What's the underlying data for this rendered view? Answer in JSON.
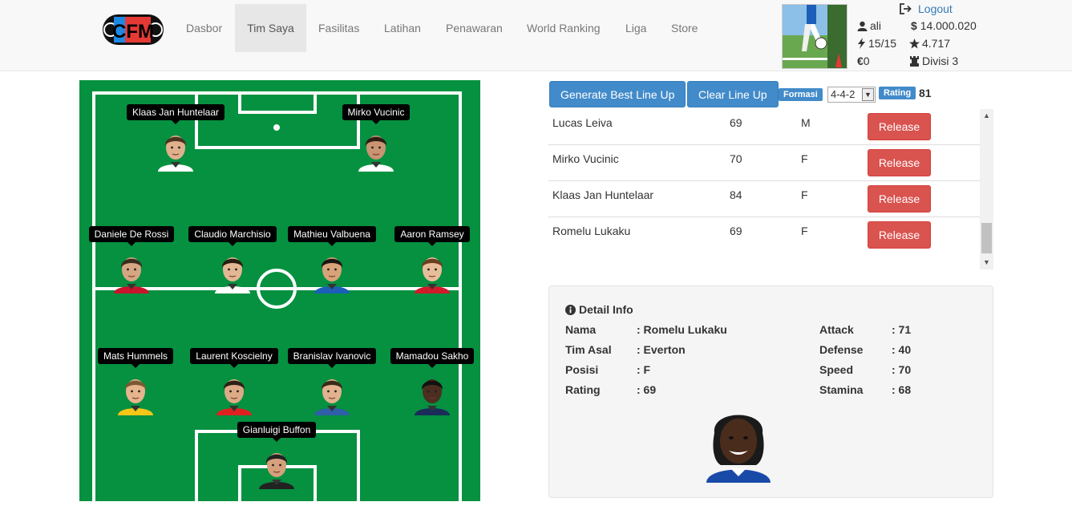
{
  "nav": {
    "logo_text": "CFM",
    "items": [
      {
        "label": "Dasbor"
      },
      {
        "label": "Tim Saya"
      },
      {
        "label": "Fasilitas"
      },
      {
        "label": "Latihan"
      },
      {
        "label": "Penawaran"
      },
      {
        "label": "World Ranking"
      },
      {
        "label": "Liga"
      },
      {
        "label": "Store"
      }
    ],
    "active_index": 1
  },
  "user": {
    "logout_label": "Logout",
    "username": "ali",
    "money": "14.000.020",
    "energy": "15/15",
    "points": "4.717",
    "euro": "0",
    "division": "Divisi 3"
  },
  "formation": {
    "players": [
      {
        "name": "Klaas Jan Huntelaar"
      },
      {
        "name": "Mirko Vucinic"
      },
      {
        "name": "Daniele De Rossi"
      },
      {
        "name": "Claudio Marchisio"
      },
      {
        "name": "Mathieu Valbuena"
      },
      {
        "name": "Aaron Ramsey"
      },
      {
        "name": "Mats Hummels"
      },
      {
        "name": "Laurent Koscielny"
      },
      {
        "name": "Branislav Ivanovic"
      },
      {
        "name": "Mamadou Sakho"
      },
      {
        "name": "Gianluigi Buffon"
      }
    ]
  },
  "toolbar": {
    "generate_label": "Generate Best Line Up",
    "clear_label": "Clear Line Up",
    "formasi_label": "Formasi",
    "formation_value": "4-4-2",
    "rating_label": "Rating",
    "rating_value": "81"
  },
  "roster": {
    "release_label": "Release",
    "rows": [
      {
        "name": "Lucas Leiva",
        "rating": "69",
        "pos": "M"
      },
      {
        "name": "Mirko Vucinic",
        "rating": "70",
        "pos": "F"
      },
      {
        "name": "Klaas Jan Huntelaar",
        "rating": "84",
        "pos": "F"
      },
      {
        "name": "Romelu Lukaku",
        "rating": "69",
        "pos": "F"
      }
    ]
  },
  "detail": {
    "title": "Detail Info",
    "left": [
      {
        "label": "Nama",
        "value": ": Romelu Lukaku"
      },
      {
        "label": "Tim Asal",
        "value": ": Everton"
      },
      {
        "label": "Posisi",
        "value": ": F"
      },
      {
        "label": "Rating",
        "value": ": 69"
      }
    ],
    "right": [
      {
        "label": "Attack",
        "value": ": 71"
      },
      {
        "label": "Defense",
        "value": ": 40"
      },
      {
        "label": "Speed",
        "value": ": 70"
      },
      {
        "label": "Stamina",
        "value": ": 68"
      }
    ]
  },
  "colors": {
    "pitch": "#059140",
    "primary": "#428bca",
    "danger": "#d9534f",
    "navbar": "#f8f8f8"
  }
}
